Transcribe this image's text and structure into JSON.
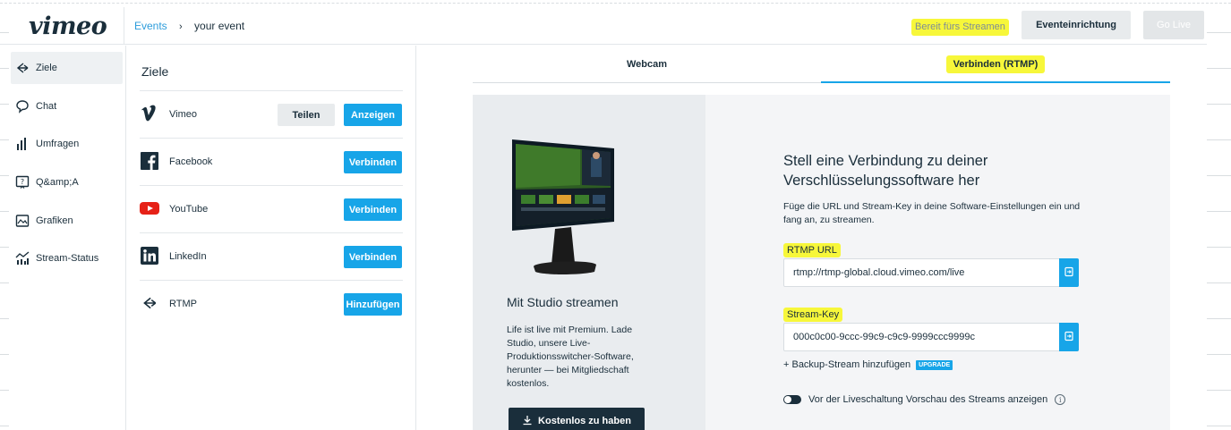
{
  "header": {
    "logo": "vimeo",
    "breadcrumb": {
      "link": "Events",
      "current": "your event"
    },
    "status": "Bereit fürs Streamen",
    "setup_label": "Eventeinrichtung",
    "golive_label": "Go Live"
  },
  "nav": {
    "items": [
      {
        "label": "Ziele",
        "icon": "rtmp-icon"
      },
      {
        "label": "Chat",
        "icon": "chat-icon"
      },
      {
        "label": "Umfragen",
        "icon": "poll-icon"
      },
      {
        "label": "Q&amp;A",
        "icon": "qa-icon"
      },
      {
        "label": "Grafiken",
        "icon": "graphics-icon"
      },
      {
        "label": "Stream-Status",
        "icon": "stream-status-icon"
      }
    ]
  },
  "destinations": {
    "title": "Ziele",
    "items": [
      {
        "name": "Vimeo",
        "share_label": "Teilen",
        "action_label": "Anzeigen"
      },
      {
        "name": "Facebook",
        "action_label": "Verbinden"
      },
      {
        "name": "YouTube",
        "action_label": "Verbinden"
      },
      {
        "name": "LinkedIn",
        "action_label": "Verbinden"
      },
      {
        "name": "RTMP",
        "action_label": "Hinzufügen"
      }
    ]
  },
  "tabs": {
    "webcam": "Webcam",
    "rtmp": "Verbinden (RTMP)"
  },
  "studio": {
    "title": "Mit Studio streamen",
    "text": "Life ist live mit Premium. Lade Studio, unsere Live-Produktionsswitcher-Software, herunter — bei Mitgliedschaft kostenlos.",
    "button": "Kostenlos zu haben"
  },
  "connect": {
    "title": "Stell eine Verbindung zu deiner Verschlüsselungssoftware her",
    "description": "Füge die URL und Stream-Key in deine Software-Einstellungen ein und fang an, zu streamen.",
    "rtmp_label": "RTMP URL",
    "rtmp_value": "rtmp://rtmp-global.cloud.vimeo.com/live",
    "key_label": "Stream-Key",
    "key_value": "000c0c00-9ccc-99c9-c9c9-9999ccc9999c",
    "backup_label": "+ Backup-Stream hinzufügen",
    "upgrade_badge": "UPGRADE",
    "preview_label": "Vor der Liveschaltung Vorschau des Streams anzeigen"
  },
  "colors": {
    "accent": "#17a5e8",
    "highlight": "#f7f73a",
    "dark": "#1a2e3b",
    "youtube": "#e62117",
    "facebook": "#1a2e3b",
    "linkedin": "#1a2e3b"
  }
}
